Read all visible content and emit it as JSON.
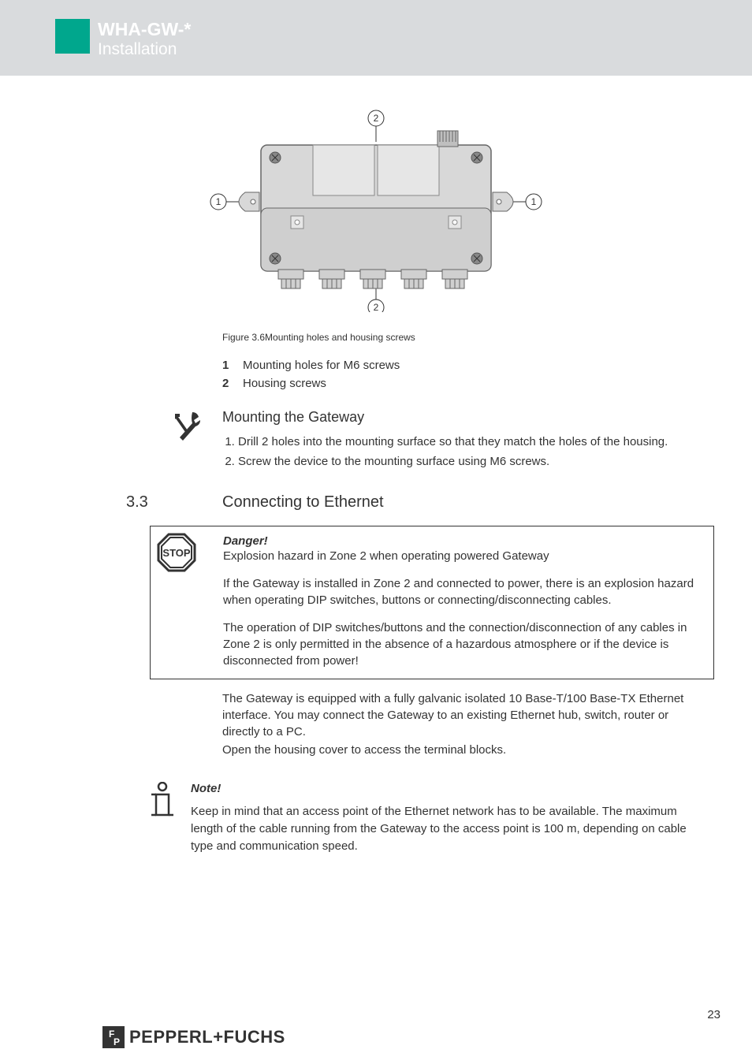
{
  "header": {
    "title": "WHA-GW-*",
    "subtitle": "Installation"
  },
  "figure": {
    "caption": "Figure 3.6Mounting holes and housing screws",
    "callouts": {
      "left": "1",
      "right": "1",
      "top": "2",
      "bottom": "2"
    }
  },
  "legend": [
    {
      "num": "1",
      "text": "Mounting holes for M6 screws"
    },
    {
      "num": "2",
      "text": "Housing screws"
    }
  ],
  "mounting": {
    "heading": "Mounting the Gateway",
    "steps": [
      "Drill 2 holes into the mounting surface so that they match the holes of the housing.",
      "Screw the device to the mounting surface using M6 screws."
    ]
  },
  "section": {
    "num": "3.3",
    "title": "Connecting to Ethernet"
  },
  "danger": {
    "title": "Danger!",
    "stop_label": "STOP",
    "p1": "Explosion hazard in Zone 2 when operating powered Gateway",
    "p2": "If the Gateway is installed in Zone 2 and connected to power, there is an explosion hazard when operating DIP switches, buttons or connecting/disconnecting cables.",
    "p3": "The operation of DIP switches/buttons and the connection/disconnection of any cables in Zone 2 is only permitted in the absence of a hazardous atmosphere or if the device is disconnected from power!"
  },
  "body": {
    "p1": "The Gateway is equipped with a fully galvanic isolated 10 Base-T/100 Base-TX Ethernet interface. You may connect the Gateway to an existing Ethernet hub, switch, router or directly to a PC.",
    "p2": "Open the housing cover to access the terminal blocks."
  },
  "note": {
    "title": "Note!",
    "text": "Keep in mind that an access point of the Ethernet network has to be available. The maximum length of the cable running from the Gateway to the access point is 100 m, depending on cable type and communication speed."
  },
  "footer": {
    "brand": "PEPPERL+FUCHS",
    "page": "23"
  }
}
